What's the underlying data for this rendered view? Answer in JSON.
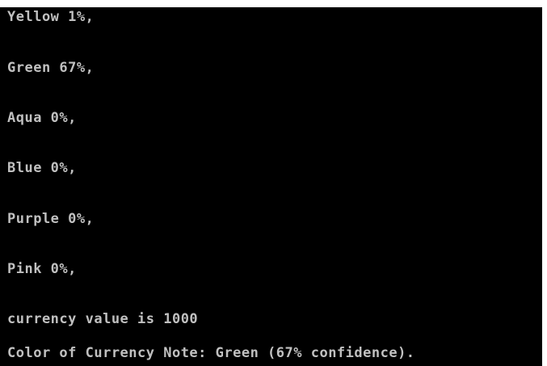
{
  "console": {
    "background_color": "#000000",
    "text_color": "#c0c0c0",
    "lines": [
      "Yellow 1%,",
      "Green 67%,",
      "Aqua 0%,",
      "Blue 0%,",
      "Purple 0%,",
      "Pink 0%,",
      "currency value is 1000",
      "Color of Currency Note: Green (67% confidence)."
    ]
  }
}
